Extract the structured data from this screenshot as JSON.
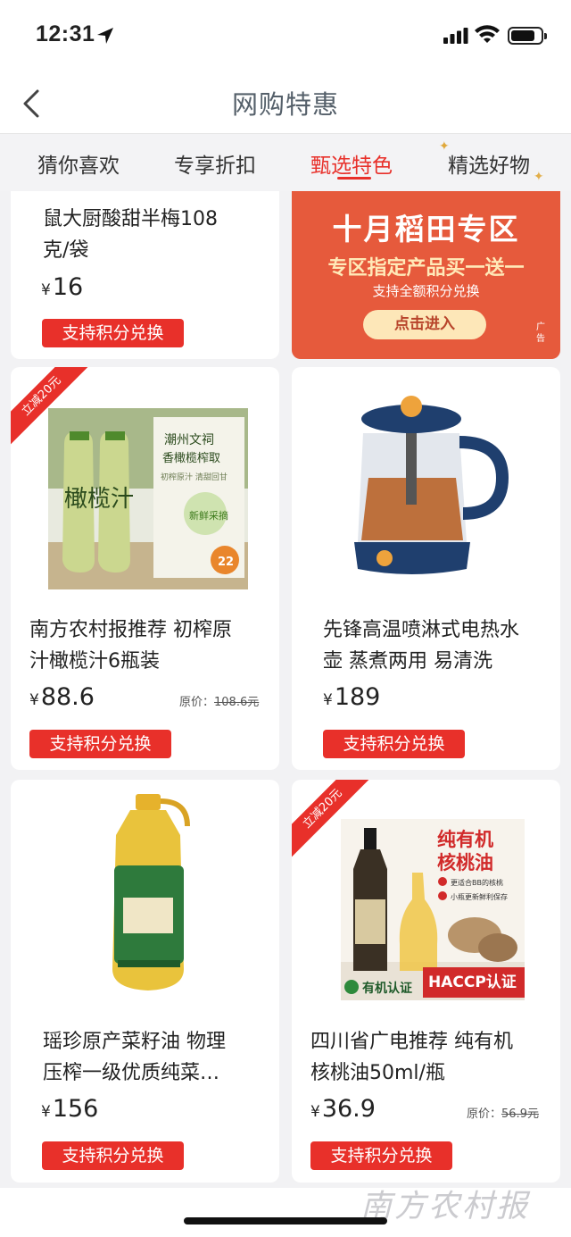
{
  "status_bar": {
    "time": "12:31"
  },
  "nav": {
    "title": "网购特惠"
  },
  "tabs": [
    {
      "label": "猜你喜欢"
    },
    {
      "label": "专享折扣"
    },
    {
      "label": "甄选特色",
      "active": true
    },
    {
      "label": "精选好物"
    }
  ],
  "ad": {
    "title": "十月稻田专区",
    "subtitle": "专区指定产品买一送一",
    "note": "支持全额积分兑换",
    "button": "点击进入",
    "label": "广告"
  },
  "products": [
    {
      "title_line1": "鼠大厨酸甜半梅108",
      "title_line2": "克/袋",
      "price": "16",
      "button": "支持积分兑换"
    },
    {
      "badge": "立减20元",
      "title_line1": "南方农村报推荐 初榨原",
      "title_line2": "汁橄榄汁6瓶装",
      "price": "88.6",
      "orig_label": "原价：",
      "orig_price": "108.6元",
      "button": "支持积分兑换",
      "image_text": {
        "brand": "潮州文祠",
        "brand2": "香橄榄榨取",
        "tagline": "初榨原汁 清甜回甘",
        "fresh": "新鲜采摘",
        "bottle": "橄榄汁"
      }
    },
    {
      "title_line1": "先锋高温喷淋式电热水",
      "title_line2": "壶 蒸煮两用 易清洗",
      "price": "189",
      "button": "支持积分兑换"
    },
    {
      "title_line1": "瑶珍原产菜籽油 物理",
      "title_line2": "压榨一级优质纯菜…",
      "price": "156",
      "button": "支持积分兑换"
    },
    {
      "badge": "立减20元",
      "title_line1": "四川省广电推荐 纯有机",
      "title_line2": "核桃油50ml/瓶",
      "price": "36.9",
      "orig_label": "原价：",
      "orig_price": "56.9元",
      "button": "支持积分兑换",
      "image_text": {
        "headline1": "纯有机",
        "headline2": "核桃油",
        "point1": "更适合BB的核桃",
        "point2": "小瓶更新鲜利保存",
        "haccp": "HACCP认证",
        "organic": "有机认证"
      }
    }
  ],
  "currency_symbol": "¥",
  "watermark": "南方农村报",
  "colors": {
    "accent": "#e8302a",
    "ad_bg": "#e65a3c"
  }
}
